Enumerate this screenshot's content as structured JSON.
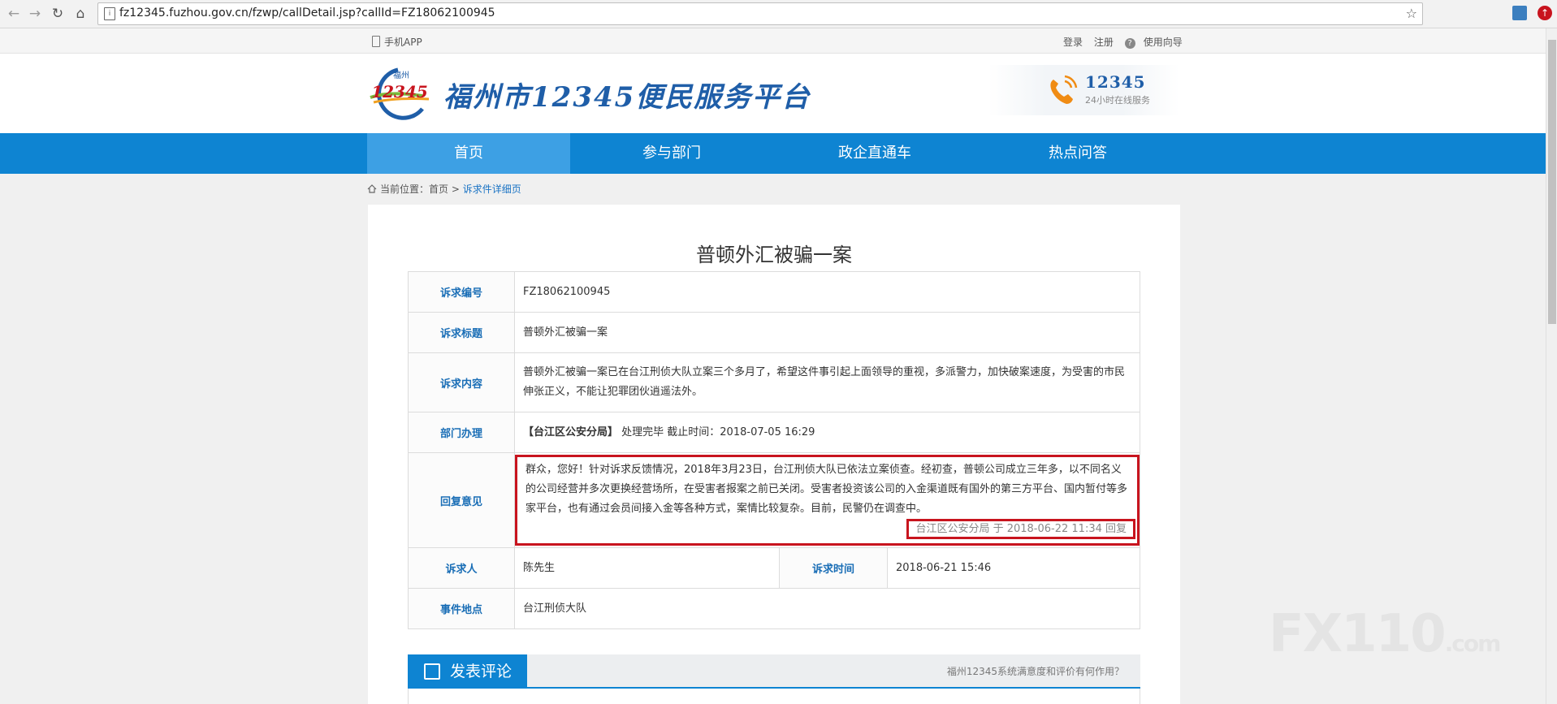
{
  "browser": {
    "url": "fz12345.fuzhou.gov.cn/fzwp/callDetail.jsp?callId=FZ18062100945"
  },
  "utilbar": {
    "mobile_app": "手机APP",
    "login": "登录",
    "register": "注册",
    "guide": "使用向导"
  },
  "header": {
    "logo_text": "12345",
    "logo_city": "福州",
    "site_name": "福州市12345便民服务平台",
    "hotline_number": "12345",
    "hotline_sub": "24小时在线服务"
  },
  "nav": {
    "items": [
      {
        "label": "首页"
      },
      {
        "label": "参与部门"
      },
      {
        "label": "政企直通车"
      },
      {
        "label": "热点问答"
      }
    ]
  },
  "breadcrumb": {
    "prefix": "当前位置：首页",
    "sep": ">",
    "current": "诉求件详细页"
  },
  "detail": {
    "title": "普顿外汇被骗一案",
    "labels": {
      "id": "诉求编号",
      "subject": "诉求标题",
      "content": "诉求内容",
      "dept": "部门办理",
      "reply": "回复意见",
      "person": "诉求人",
      "time": "诉求时间",
      "location": "事件地点"
    },
    "id": "FZ18062100945",
    "subject": "普顿外汇被骗一案",
    "content": "普顿外汇被骗一案已在台江刑侦大队立案三个多月了，希望这件事引起上面领导的重视，多派警力，加快破案速度，为受害的市民伸张正义，不能让犯罪团伙逍遥法外。",
    "dept_name": "【台江区公安分局】",
    "dept_status": "处理完毕 截止时间：2018-07-05 16:29",
    "reply_text": "群众，您好！针对诉求反馈情况，2018年3月23日，台江刑侦大队已依法立案侦查。经初查，普顿公司成立三年多，以不同名义的公司经营并多次更换经营场所，在受害者报案之前已关闭。受害者投资该公司的入金渠道既有国外的第三方平台、国内暂付等多家平台，也有通过会员间接入金等各种方式，案情比较复杂。目前，民警仍在调查中。",
    "reply_sign": "台江区公安分局 于 2018-06-22 11:34 回复",
    "person": "陈先生",
    "time": "2018-06-21 15:46",
    "location": "台江刑侦大队"
  },
  "comments": {
    "tab_label": "发表评论",
    "help_link": "福州12345系统满意度和评价有何作用？"
  },
  "watermark": {
    "main": "FX110",
    "suffix": ".com"
  },
  "colors": {
    "nav_blue": "#0e84d2",
    "nav_active": "#3da0e4",
    "label_blue": "#1a6eb6",
    "highlight_red": "#c8141e"
  }
}
